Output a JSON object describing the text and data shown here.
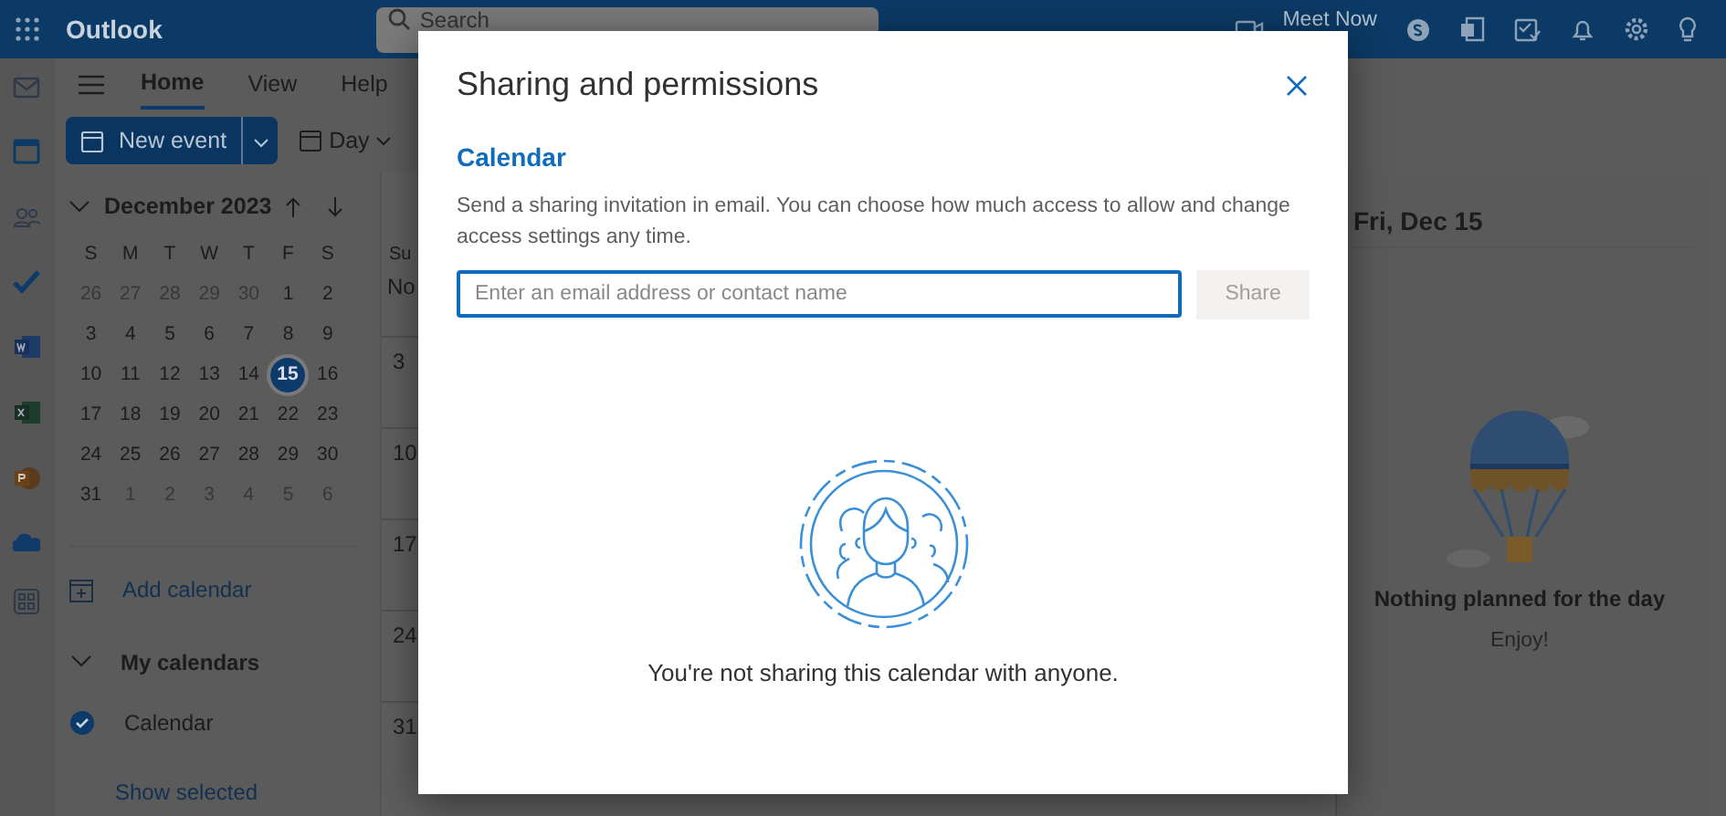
{
  "topbar": {
    "app_name": "Outlook",
    "search": {
      "placeholder": "Search"
    },
    "meet_now": "Meet Now"
  },
  "ribbon": {
    "tabs": [
      {
        "label": "Home",
        "selected": true
      },
      {
        "label": "View",
        "selected": false
      },
      {
        "label": "Help",
        "selected": false
      }
    ],
    "new_event": "New event",
    "view_picker": "Day"
  },
  "mini_calendar": {
    "month": "December 2023",
    "weekdays": [
      "S",
      "M",
      "T",
      "W",
      "T",
      "F",
      "S"
    ],
    "weeks": [
      [
        {
          "day": "26",
          "in_month": false,
          "selected": false
        },
        {
          "day": "27",
          "in_month": false,
          "selected": false
        },
        {
          "day": "28",
          "in_month": false,
          "selected": false
        },
        {
          "day": "29",
          "in_month": false,
          "selected": false
        },
        {
          "day": "30",
          "in_month": false,
          "selected": false
        },
        {
          "day": "1",
          "in_month": true,
          "selected": false
        },
        {
          "day": "2",
          "in_month": true,
          "selected": false
        }
      ],
      [
        {
          "day": "3",
          "in_month": true,
          "selected": false
        },
        {
          "day": "4",
          "in_month": true,
          "selected": false
        },
        {
          "day": "5",
          "in_month": true,
          "selected": false
        },
        {
          "day": "6",
          "in_month": true,
          "selected": false
        },
        {
          "day": "7",
          "in_month": true,
          "selected": false
        },
        {
          "day": "8",
          "in_month": true,
          "selected": false
        },
        {
          "day": "9",
          "in_month": true,
          "selected": false
        }
      ],
      [
        {
          "day": "10",
          "in_month": true,
          "selected": false
        },
        {
          "day": "11",
          "in_month": true,
          "selected": false
        },
        {
          "day": "12",
          "in_month": true,
          "selected": false
        },
        {
          "day": "13",
          "in_month": true,
          "selected": false
        },
        {
          "day": "14",
          "in_month": true,
          "selected": false
        },
        {
          "day": "15",
          "in_month": true,
          "selected": true
        },
        {
          "day": "16",
          "in_month": true,
          "selected": false
        }
      ],
      [
        {
          "day": "17",
          "in_month": true,
          "selected": false
        },
        {
          "day": "18",
          "in_month": true,
          "selected": false
        },
        {
          "day": "19",
          "in_month": true,
          "selected": false
        },
        {
          "day": "20",
          "in_month": true,
          "selected": false
        },
        {
          "day": "21",
          "in_month": true,
          "selected": false
        },
        {
          "day": "22",
          "in_month": true,
          "selected": false
        },
        {
          "day": "23",
          "in_month": true,
          "selected": false
        }
      ],
      [
        {
          "day": "24",
          "in_month": true,
          "selected": false
        },
        {
          "day": "25",
          "in_month": true,
          "selected": false
        },
        {
          "day": "26",
          "in_month": true,
          "selected": false
        },
        {
          "day": "27",
          "in_month": true,
          "selected": false
        },
        {
          "day": "28",
          "in_month": true,
          "selected": false
        },
        {
          "day": "29",
          "in_month": true,
          "selected": false
        },
        {
          "day": "30",
          "in_month": true,
          "selected": false
        }
      ],
      [
        {
          "day": "31",
          "in_month": true,
          "selected": false
        },
        {
          "day": "1",
          "in_month": false,
          "selected": false
        },
        {
          "day": "2",
          "in_month": false,
          "selected": false
        },
        {
          "day": "3",
          "in_month": false,
          "selected": false
        },
        {
          "day": "4",
          "in_month": false,
          "selected": false
        },
        {
          "day": "5",
          "in_month": false,
          "selected": false
        },
        {
          "day": "6",
          "in_month": false,
          "selected": false
        }
      ]
    ]
  },
  "add_calendar": "Add calendar",
  "my_calendars": {
    "title": "My calendars",
    "expanded": true,
    "items": [
      {
        "name": "Calendar",
        "checked": true
      }
    ]
  },
  "show_selected": "Show selected",
  "week_grid": {
    "column_header": "Su",
    "month_label": "No",
    "rows": [
      "3",
      "10",
      "17",
      "24",
      "31"
    ]
  },
  "day_pane": {
    "date": "Fri, Dec 15",
    "empty_title": "Nothing planned for the day",
    "empty_subtitle": "Enjoy!"
  },
  "dialog": {
    "title": "Sharing and permissions",
    "section": "Calendar",
    "description": "Send a sharing invitation in email. You can choose how much access to allow and change access settings any time.",
    "email": {
      "placeholder": "Enter an email address or contact name"
    },
    "share_button": {
      "label": "Share",
      "disabled": true
    },
    "empty_message": "You're not sharing this calendar with anyone."
  }
}
